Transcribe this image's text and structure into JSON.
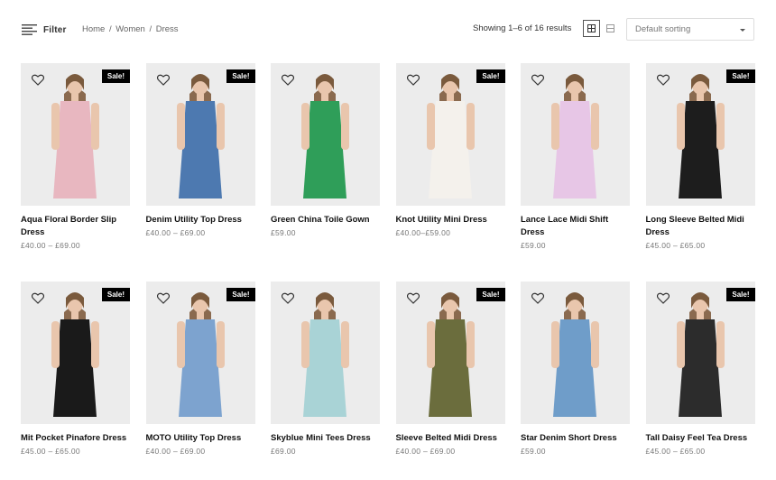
{
  "toolbar": {
    "filter_label": "Filter",
    "breadcrumb": [
      "Home",
      "Women",
      "Dress"
    ],
    "breadcrumb_separator": "/",
    "results_text": "Showing 1–6 of 16 results",
    "sort_selected": "Default sorting",
    "view_grid_icon": "grid-view-icon",
    "view_list_icon": "list-view-icon"
  },
  "sale_badge": "Sale!",
  "products": [
    {
      "name": "Aqua Floral Border Slip Dress",
      "price": "£40.00 – £69.00",
      "sale": true,
      "icon": "dress-photo",
      "color": "#e8b7c0"
    },
    {
      "name": "Denim Utility Top Dress",
      "price": "£40.00 – £69.00",
      "sale": true,
      "icon": "dress-photo",
      "color": "#4d79b0"
    },
    {
      "name": "Green China Toile Gown",
      "price": "£59.00",
      "sale": false,
      "icon": "dress-photo",
      "color": "#2f9e59"
    },
    {
      "name": "Knot Utility Mini Dress",
      "price": "£40.00–£59.00",
      "sale": true,
      "icon": "dress-photo",
      "color": "#f4f1ec"
    },
    {
      "name": "Lance Lace Midi Shift Dress",
      "price": "£59.00",
      "sale": false,
      "icon": "dress-photo",
      "color": "#e7c6e6"
    },
    {
      "name": "Long Sleeve Belted Midi Dress",
      "price": "£45.00 – £65.00",
      "sale": true,
      "icon": "dress-photo",
      "color": "#1d1d1d"
    },
    {
      "name": "Mit Pocket Pinafore Dress",
      "price": "£45.00 – £65.00",
      "sale": true,
      "icon": "dress-photo",
      "color": "#1a1a1a"
    },
    {
      "name": "MOTO Utility Top Dress",
      "price": "£40.00 – £69.00",
      "sale": true,
      "icon": "dress-photo",
      "color": "#7da3cf"
    },
    {
      "name": "Skyblue Mini Tees Dress",
      "price": "£69.00",
      "sale": false,
      "icon": "dress-photo",
      "color": "#a9d3d6"
    },
    {
      "name": "Sleeve Belted Midi Dress",
      "price": "£40.00 – £69.00",
      "sale": true,
      "icon": "dress-photo",
      "color": "#6b6d3d"
    },
    {
      "name": "Star Denim Short Dress",
      "price": "£59.00",
      "sale": false,
      "icon": "dress-photo",
      "color": "#6f9dc9"
    },
    {
      "name": "Tall Daisy Feel Tea Dress",
      "price": "£45.00 – £65.00",
      "sale": true,
      "icon": "dress-photo",
      "color": "#2c2c2c"
    }
  ]
}
